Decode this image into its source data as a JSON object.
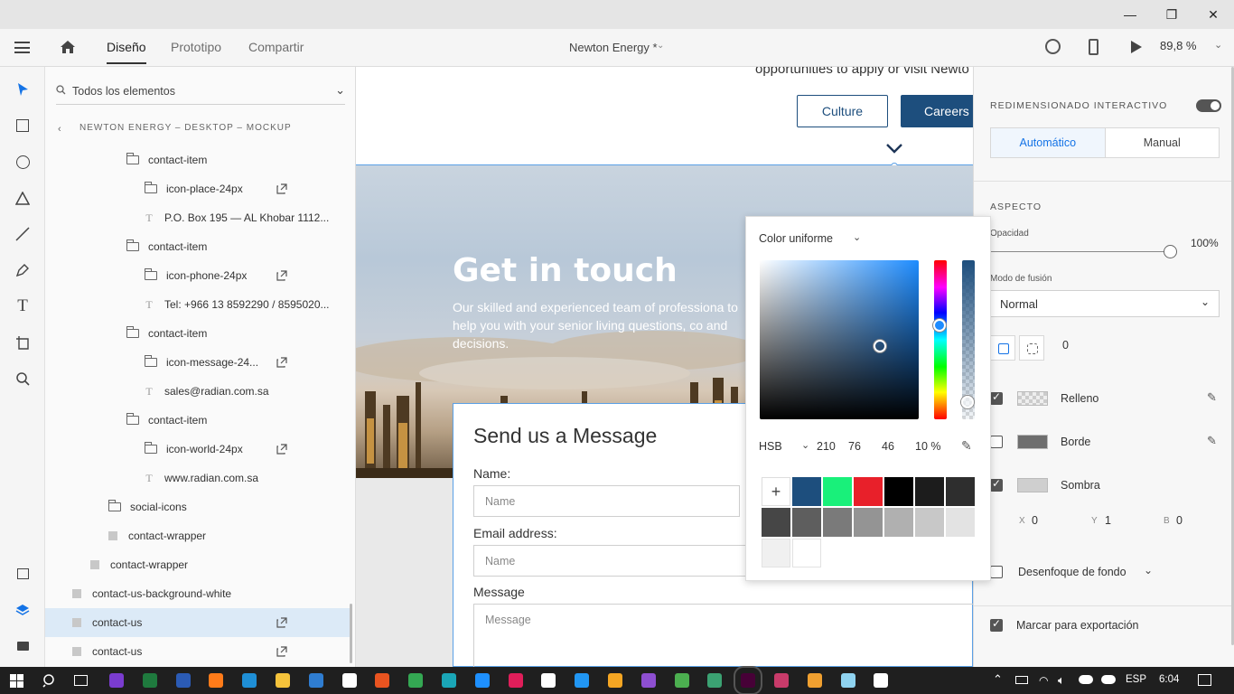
{
  "window": {
    "minimize": "—",
    "restore": "❐",
    "close": "✕"
  },
  "appbar": {
    "tabs": [
      {
        "label": "Diseño"
      },
      {
        "label": "Prototipo"
      },
      {
        "label": "Compartir"
      }
    ],
    "document_title": "Newton Energy *",
    "zoom": "89,8 %"
  },
  "tools": [
    "select-icon",
    "rectangle-icon",
    "ellipse-icon",
    "polygon-icon",
    "line-icon",
    "pen-icon",
    "text-icon",
    "artboard-icon",
    "zoom-icon"
  ],
  "layers": {
    "search_placeholder": "Todos los elementos",
    "breadcrumb": "NEWTON ENERGY – DESKTOP – MOCKUP",
    "items": [
      {
        "label": "contact-item",
        "kind": "folder",
        "indent": 1
      },
      {
        "label": "icon-place-24px",
        "kind": "folder",
        "indent": 2,
        "link": true
      },
      {
        "label": "P.O. Box 195 — AL Khobar 1112...",
        "kind": "text",
        "indent": 2
      },
      {
        "label": "contact-item",
        "kind": "folder",
        "indent": 1
      },
      {
        "label": "icon-phone-24px",
        "kind": "folder",
        "indent": 2,
        "link": true
      },
      {
        "label": "Tel: +966 13 8592290 / 8595020...",
        "kind": "text",
        "indent": 2
      },
      {
        "label": "contact-item",
        "kind": "folder",
        "indent": 1
      },
      {
        "label": "icon-message-24...",
        "kind": "folder",
        "indent": 2,
        "link": true
      },
      {
        "label": "sales@radian.com.sa",
        "kind": "text",
        "indent": 2
      },
      {
        "label": "contact-item",
        "kind": "folder",
        "indent": 1
      },
      {
        "label": "icon-world-24px",
        "kind": "folder",
        "indent": 2,
        "link": true
      },
      {
        "label": "www.radian.com.sa",
        "kind": "text",
        "indent": 2
      },
      {
        "label": "social-icons",
        "kind": "folder",
        "indent": 0
      },
      {
        "label": "contact-wrapper",
        "kind": "rect",
        "indent": 0
      },
      {
        "label": "contact-wrapper",
        "kind": "rect",
        "indent": -1
      },
      {
        "label": "contact-us-background-white",
        "kind": "rect",
        "indent": -2
      },
      {
        "label": "contact-us",
        "kind": "rect",
        "indent": -2,
        "link": true,
        "selected": true
      },
      {
        "label": "contact-us",
        "kind": "rect",
        "indent": -2,
        "link": true
      }
    ]
  },
  "canvas": {
    "top_text": "opportunities to apply or visit Newto",
    "btn_culture": "Culture",
    "btn_careers": "Careers",
    "hero_title": "Get in touch",
    "hero_text": "Our skilled and experienced team of professiona to help you with your  senior living questions, co and decisions.",
    "form_title": "Send us a Message",
    "name_label": "Name:",
    "name_placeholder": "Name",
    "email_label": "Email address:",
    "email_placeholder": "Name",
    "message_label": "Message",
    "message_placeholder": "Message"
  },
  "picker": {
    "mode": "Color uniforme",
    "model": "HSB",
    "h": "210",
    "s": "76",
    "b": "46",
    "alpha": "10 %",
    "add": "+",
    "swatches": [
      "#1d4e7d",
      "#19f07a",
      "#e8202a",
      "#000000",
      "#1c1c1c",
      "#2e2e2e",
      "#464646",
      "#5e5e5e",
      "#7a7a7a",
      "#949494",
      "#b0b0b0",
      "#c8c8c8",
      "#e3e3e3",
      "#f0f0f0",
      "#ffffff"
    ]
  },
  "props": {
    "responsive_title": "REDIMENSIONADO INTERACTIVO",
    "seg_auto": "Automático",
    "seg_manual": "Manual",
    "aspect_title": "ASPECTO",
    "opacity_label": "Opacidad",
    "opacity_value": "100%",
    "blend_label": "Modo de fusión",
    "blend_value": "Normal",
    "radius_value": "0",
    "fill_label": "Relleno",
    "border_label": "Borde",
    "shadow_label": "Sombra",
    "shadow_x_label": "X",
    "shadow_x": "0",
    "shadow_y_label": "Y",
    "shadow_y": "1",
    "shadow_b_label": "B",
    "shadow_b": "0",
    "blur_label": "Desenfoque de fondo",
    "export_label": "Marcar para exportación"
  },
  "taskbar": {
    "lang": "ESP",
    "time": "6:04"
  }
}
